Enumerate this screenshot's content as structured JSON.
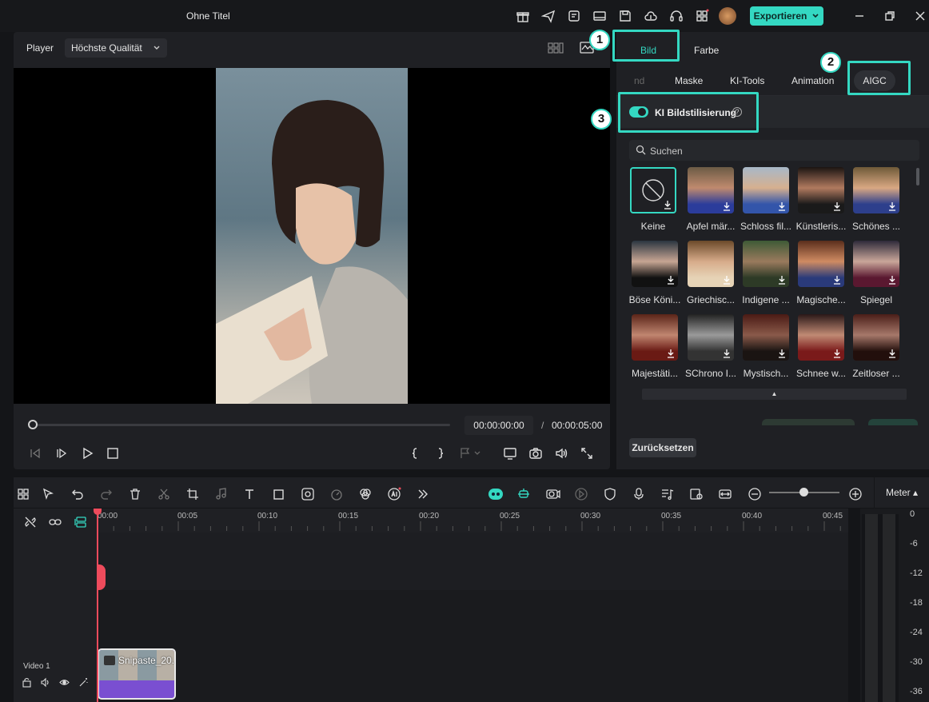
{
  "titlebar": {
    "title": "Ohne Titel",
    "export_label": "Exportieren"
  },
  "player": {
    "label": "Player",
    "quality": "Höchste Qualität",
    "timecode_current": "00:00:00:00",
    "timecode_separator": "/",
    "timecode_total": "00:00:05:00"
  },
  "right_panel": {
    "main_tabs": [
      "Bild",
      "Farbe"
    ],
    "sub_tabs": [
      "nd",
      "Maske",
      "KI-Tools",
      "Animation",
      "AIGC"
    ],
    "ai_style_label": "KI Bildstilisierung",
    "ai_style_enabled": true,
    "search_placeholder": "Suchen",
    "reset_label": "Zurücksetzen",
    "styles": [
      {
        "label": "Keine",
        "selected": true
      },
      {
        "label": "Apfel mär..."
      },
      {
        "label": "Schloss fil..."
      },
      {
        "label": "Künstleris..."
      },
      {
        "label": "Schönes ..."
      },
      {
        "label": "Böse Köni..."
      },
      {
        "label": "Griechisc..."
      },
      {
        "label": "Indigene ..."
      },
      {
        "label": "Magische..."
      },
      {
        "label": "Spiegel"
      },
      {
        "label": "Majestäti..."
      },
      {
        "label": "SChrono I..."
      },
      {
        "label": "Mystisch..."
      },
      {
        "label": "Schnee w..."
      },
      {
        "label": "Zeitloser ..."
      }
    ]
  },
  "annotations": [
    "1",
    "2",
    "3"
  ],
  "timeline": {
    "meter_label": "Meter",
    "ticks": [
      "00:00",
      "00:05",
      "00:10",
      "00:15",
      "00:20",
      "00:25",
      "00:30",
      "00:35",
      "00:40",
      "00:45"
    ],
    "track_name": "Video 1",
    "clip_name": "Snipaste_20...",
    "meter_scale": [
      "0",
      "-6",
      "-12",
      "-18",
      "-24",
      "-30",
      "-36"
    ]
  },
  "colors": {
    "accent": "#34d8c2",
    "playhead": "#ee4b5c",
    "clip": "#7a4fd1"
  }
}
